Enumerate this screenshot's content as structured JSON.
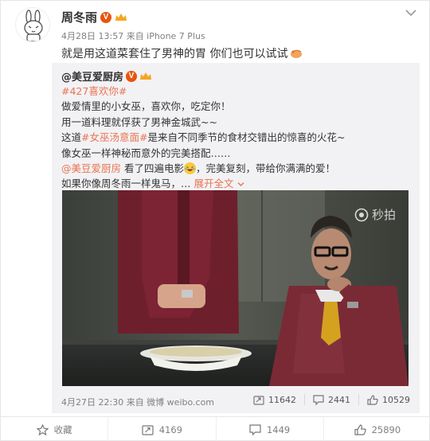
{
  "post": {
    "author": "周冬雨",
    "meta": "4月28日 13:57 来自 iPhone 7 Plus",
    "text": "就是用这道菜套住了男神的胃 你们也可以试试"
  },
  "repost": {
    "author": "@美豆爱厨房",
    "tag": "#427喜欢你#",
    "lines": {
      "l2": "做爱情里的小女巫，喜欢你，吃定你！",
      "l3": "用一道料理就俘获了男神金城武~~",
      "l4_pre": "这道",
      "l4_link": "#女巫汤意面#",
      "l4_post": "是来自不同季节的食材交错出的惊喜的火花~",
      "l5": "像女巫一样神秘而意外的完美搭配……",
      "l6_mention": "@美豆爱厨房",
      "l6_mid": " 看了四遍电影",
      "l6_post": "，完美复刻，带给你满满的爱！",
      "l7": "如果你像周冬雨一样鬼马，…",
      "l7_expand": "展开全文"
    },
    "watermark": "秒拍",
    "footer": "4月27日 22:30 来自 微博 weibo.com",
    "stats": {
      "repost": "11642",
      "comment": "2441",
      "like": "10529"
    }
  },
  "actions": {
    "collect": "收藏",
    "repost": "4169",
    "comment": "1449",
    "like": "25890"
  },
  "colors": {
    "link": "#eb7350",
    "vbadge": "#e8550e",
    "crown": "#f5a623",
    "text": "#333333",
    "muted": "#808080"
  },
  "icons": [
    "rabbit-avatar",
    "verified-icon",
    "crown-icon",
    "chevron-down-icon",
    "hand-emoji",
    "laugh-emoji",
    "miaopai-logo-icon",
    "repost-icon",
    "comment-icon",
    "like-icon",
    "star-icon"
  ]
}
